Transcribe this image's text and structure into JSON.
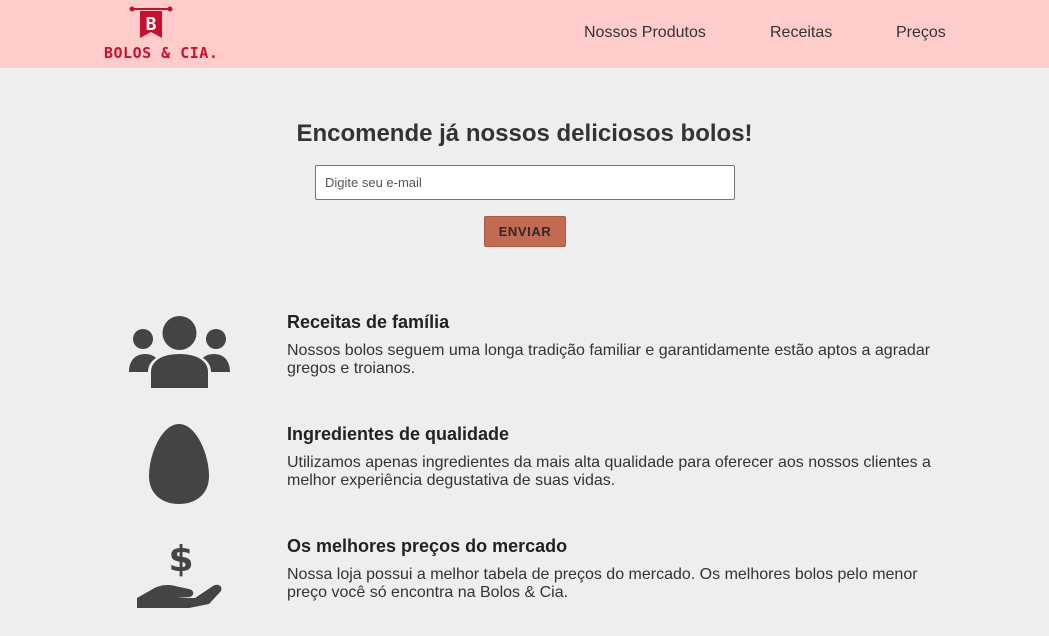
{
  "header": {
    "logo_text": "BOLOS & CIA.",
    "logo_letter": "B",
    "brand_color": "#c8102e",
    "background": "#ffcccc",
    "nav": [
      {
        "label": "Nossos Produtos"
      },
      {
        "label": "Receitas"
      },
      {
        "label": "Preços"
      }
    ]
  },
  "hero": {
    "title": "Encomende já nossos deliciosos bolos!",
    "email_placeholder": "Digite seu e-mail",
    "submit_label": "ENVIAR",
    "button_color": "#c46a52"
  },
  "features": [
    {
      "icon": "users-icon",
      "title": "Receitas de família",
      "text": "Nossos bolos seguem uma longa tradição familiar e garantidamente estão aptos a agradar gregos e troianos."
    },
    {
      "icon": "egg-icon",
      "title": "Ingredientes de qualidade",
      "text": "Utilizamos apenas ingredientes da mais alta qualidade para oferecer aos nossos clientes a melhor experiência degustativa de suas vidas."
    },
    {
      "icon": "hand-holding-dollar-icon",
      "title": "Os melhores preços do mercado",
      "text": "Nossa loja possui a melhor tabela de preços do mercado. Os melhores bolos pelo menor preço você só encontra na Bolos & Cia."
    }
  ]
}
